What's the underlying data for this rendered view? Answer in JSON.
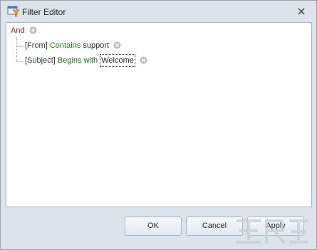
{
  "window": {
    "title": "Filter Editor"
  },
  "filter": {
    "group_operator": "And",
    "conditions": [
      {
        "field": "[From]",
        "operator": "Contains",
        "value": "support"
      },
      {
        "field": "[Subject]",
        "operator": "Begins with",
        "value": "Welcome"
      }
    ]
  },
  "buttons": {
    "ok": "OK",
    "cancel": "Cancel",
    "apply": "Apply"
  },
  "colors": {
    "group_operator": "#8b1c1c",
    "operator": "#1d7a16",
    "field": "#2f3b4a"
  },
  "icons": {
    "title": "filter-editor-icon",
    "close": "close-icon",
    "add": "add-condition-icon",
    "remove": "remove-condition-icon"
  }
}
